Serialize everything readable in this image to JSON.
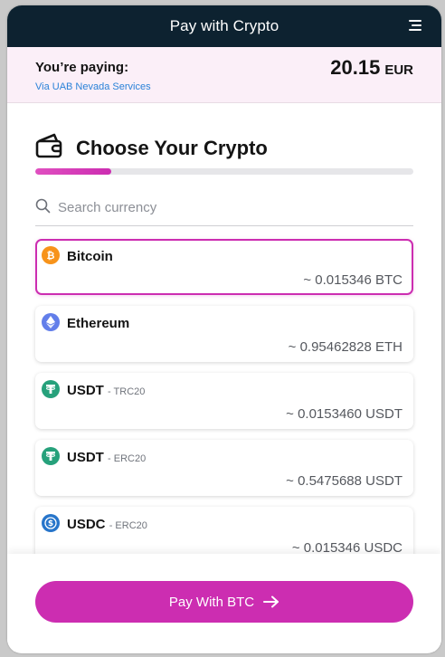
{
  "header": {
    "title": "Pay with Crypto",
    "menu_icon": "hamburger-menu-icon"
  },
  "payment": {
    "label": "You’re paying:",
    "merchant": "Via UAB Nevada Services",
    "amount": "20.15",
    "currency": "EUR"
  },
  "step": {
    "title": "Choose Your Crypto",
    "icon": "wallet-icon",
    "progress": 0.2
  },
  "search": {
    "placeholder": "Search currency",
    "value": ""
  },
  "currencies": [
    {
      "name": "Bitcoin",
      "network": "",
      "amount": "~ 0.015346 BTC",
      "icon": "bitcoin-icon",
      "color": "#F7931A",
      "selected": true
    },
    {
      "name": "Ethereum",
      "network": "",
      "amount": "~ 0.95462828 ETH",
      "icon": "ethereum-icon",
      "color": "#627EEA",
      "selected": false
    },
    {
      "name": "USDT",
      "network": "- TRC20",
      "amount": "~ 0.0153460 USDT",
      "icon": "tether-icon",
      "color": "#26A17B",
      "selected": false
    },
    {
      "name": "USDT",
      "network": "- ERC20",
      "amount": "~ 0.5475688 USDT",
      "icon": "tether-icon",
      "color": "#26A17B",
      "selected": false
    },
    {
      "name": "USDC",
      "network": "- ERC20",
      "amount": "~ 0.015346 USDC",
      "icon": "usdc-icon",
      "color": "#2775CA",
      "selected": false
    }
  ],
  "action": {
    "label": "Pay With BTC",
    "icon": "arrow-right-icon",
    "color": "#CC2DB1"
  }
}
